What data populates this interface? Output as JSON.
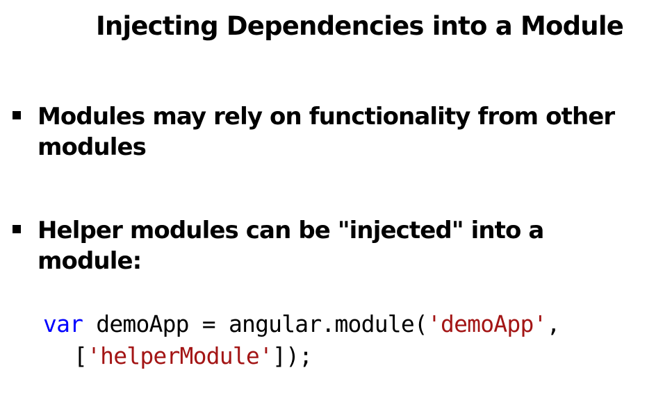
{
  "slide": {
    "title": "Injecting Dependencies into a Module",
    "bullets": [
      "Modules may rely on functionality from other modules",
      "Helper modules can be \"injected\" into a module:"
    ],
    "code": {
      "line1": {
        "keyword": "var",
        "text1": " demoApp = angular.module(",
        "string1": "'demoApp'",
        "text2": ","
      },
      "line2": {
        "text1": "[",
        "string1": "'helperModule'",
        "text2": "]);"
      }
    },
    "colors": {
      "keyword": "#0000ff",
      "string": "#a31515",
      "text": "#000000"
    }
  }
}
